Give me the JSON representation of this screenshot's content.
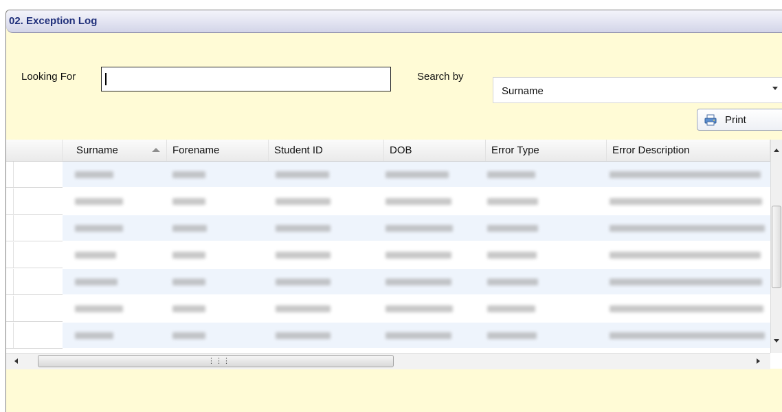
{
  "window": {
    "title": "02. Exception Log"
  },
  "search": {
    "looking_for_label": "Looking For",
    "looking_for_value": "",
    "search_by_label": "Search by",
    "search_by_value": "Surname"
  },
  "toolbar": {
    "print_label": "Print"
  },
  "grid": {
    "columns": [
      "Surname",
      "Forename",
      "Student ID",
      "DOB",
      "Error Type",
      "Error Description"
    ],
    "sorted_column": "Surname",
    "sort_direction": "ascending",
    "row_count_visible": 7,
    "cell_values_note": "redacted"
  },
  "colors": {
    "window_background": "#fffbd6",
    "title_text": "#1f2f7a",
    "alternate_row": "#eef4fc"
  }
}
